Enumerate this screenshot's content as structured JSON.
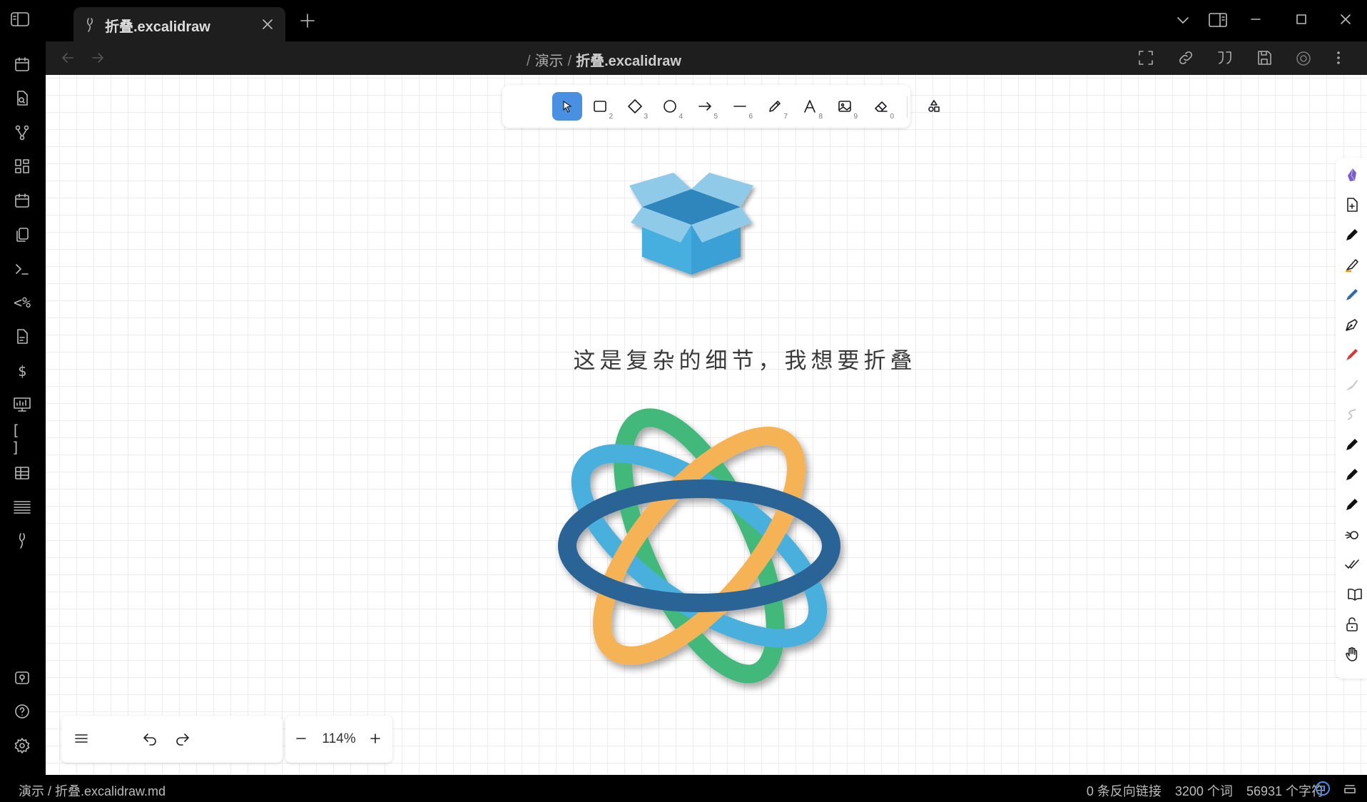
{
  "tab": {
    "title": "折叠.excalidraw"
  },
  "breadcrumb": {
    "folder": "演示",
    "file": "折叠.excalidraw"
  },
  "ribbon": {
    "template_text": "<%",
    "dollar_text": "$",
    "bracket_text": "[ ]"
  },
  "toolbar": {
    "keys": {
      "rectangle": "2",
      "diamond": "3",
      "ellipse": "4",
      "arrow": "5",
      "line": "6",
      "draw": "7",
      "text": "8",
      "image": "9",
      "eraser": "0"
    }
  },
  "canvas": {
    "text": "这是复杂的细节，我想要折叠"
  },
  "zoom": {
    "level": "114%"
  },
  "status": {
    "path": "演示 / 折叠.excalidraw.md",
    "backlinks": "0 条反向链接",
    "words": "3200 个词",
    "chars": "56931 个字符"
  },
  "colors": {
    "accent": "#4a90e2",
    "knot_blue_dark": "#2a6495",
    "knot_blue_light": "#4ab0dd",
    "knot_green": "#43b97a",
    "knot_orange": "#f6b356",
    "box_blue": "#47aee0"
  }
}
